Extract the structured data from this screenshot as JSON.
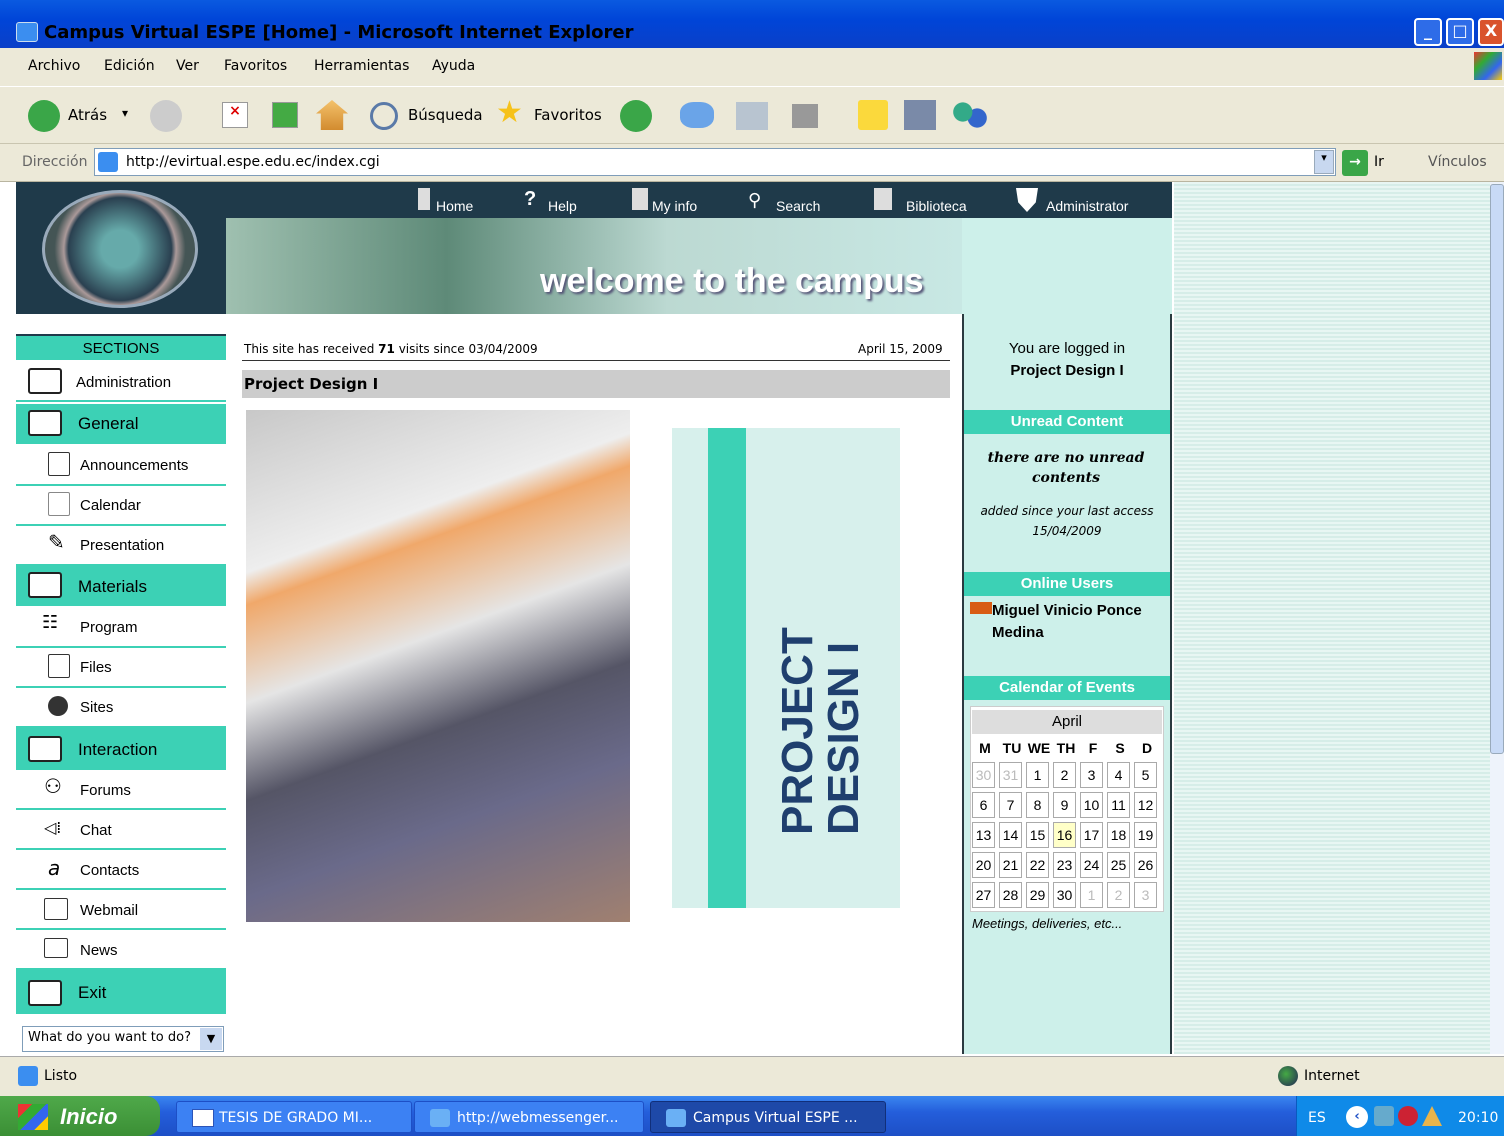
{
  "window": {
    "title": "Campus Virtual ESPE [Home] - Microsoft Internet Explorer"
  },
  "menu": [
    "Archivo",
    "Edición",
    "Ver",
    "Favoritos",
    "Herramientas",
    "Ayuda"
  ],
  "toolbar": {
    "back": "Atrás",
    "search": "Búsqueda",
    "favorites": "Favoritos"
  },
  "address": {
    "label": "Dirección",
    "url": "http://evirtual.espe.edu.ec/index.cgi",
    "go": "Ir",
    "links": "Vínculos"
  },
  "nav": [
    "Home",
    "Help",
    "My info",
    "Search",
    "Biblioteca",
    "Administrator"
  ],
  "banner": {
    "text": "welcome to the campus"
  },
  "sidebar": {
    "title": "SECTIONS",
    "items": [
      {
        "label": "Administration",
        "type": "item"
      },
      {
        "label": "General",
        "type": "section"
      },
      {
        "label": "Announcements",
        "type": "item"
      },
      {
        "label": "Calendar",
        "type": "item"
      },
      {
        "label": "Presentation",
        "type": "item"
      },
      {
        "label": "Materials",
        "type": "section"
      },
      {
        "label": "Program",
        "type": "item"
      },
      {
        "label": "Files",
        "type": "item"
      },
      {
        "label": "Sites",
        "type": "item"
      },
      {
        "label": "Interaction",
        "type": "section"
      },
      {
        "label": "Forums",
        "type": "item"
      },
      {
        "label": "Chat",
        "type": "item"
      },
      {
        "label": "Contacts",
        "type": "item"
      },
      {
        "label": "Webmail",
        "type": "item"
      },
      {
        "label": "News",
        "type": "item"
      },
      {
        "label": "Exit",
        "type": "section"
      }
    ],
    "select": "What do you want to do?"
  },
  "main": {
    "visits_prefix": "This site has received",
    "visits_count": "71",
    "visits_suffix": "visits since 03/04/2009",
    "date": "April 15, 2009",
    "course_title": "Project Design I",
    "poster_line1": "PROJECT",
    "poster_line2": "DESIGN I"
  },
  "right": {
    "logged_in": "You are logged in",
    "course": "Project Design I",
    "unread_title": "Unread Content",
    "unread_msg": "there are no unread contents",
    "since": "added since your last access",
    "since_date": "15/04/2009",
    "online_title": "Online Users",
    "online_user": "Miguel Vinicio Ponce Medina",
    "calendar_title": "Calendar of Events",
    "month": "April",
    "weekdays": [
      "M",
      "TU",
      "WE",
      "TH",
      "F",
      "S",
      "D"
    ],
    "weeks": [
      [
        "30",
        "31",
        "1",
        "2",
        "3",
        "4",
        "5"
      ],
      [
        "6",
        "7",
        "8",
        "9",
        "10",
        "11",
        "12"
      ],
      [
        "13",
        "14",
        "15",
        "16",
        "17",
        "18",
        "19"
      ],
      [
        "20",
        "21",
        "22",
        "23",
        "24",
        "25",
        "26"
      ],
      [
        "27",
        "28",
        "29",
        "30",
        "1",
        "2",
        "3"
      ]
    ],
    "today": "16",
    "footer": "Meetings, deliveries, etc..."
  },
  "status": {
    "text": "Listo",
    "zone": "Internet"
  },
  "taskbar": {
    "start": "Inicio",
    "tasks": [
      "TESIS DE GRADO MI...",
      "http://webmessenger...",
      "Campus Virtual ESPE ..."
    ],
    "lang": "ES",
    "time": "20:10"
  }
}
